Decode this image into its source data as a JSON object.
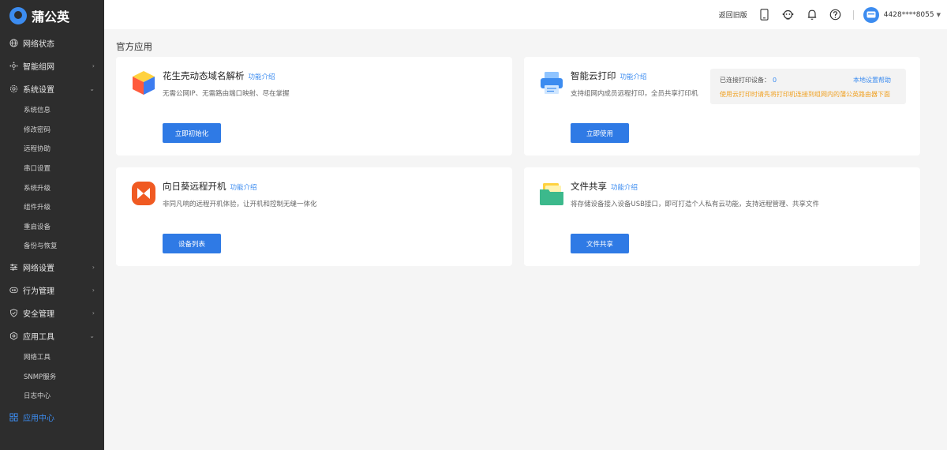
{
  "logo": {
    "text": "蒲公英"
  },
  "sidebar": {
    "items": [
      {
        "label": "网络状态",
        "icon": "globe-icon",
        "expandable": false
      },
      {
        "label": "智能组网",
        "icon": "network-icon",
        "expandable": true
      },
      {
        "label": "系统设置",
        "icon": "gear-icon",
        "expandable": true,
        "expanded": true,
        "children": [
          "系统信息",
          "修改密码",
          "远程协助",
          "串口设置",
          "系统升级",
          "组件升级",
          "重启设备",
          "备份与恢复"
        ]
      },
      {
        "label": "网络设置",
        "icon": "sliders-icon",
        "expandable": true
      },
      {
        "label": "行为管理",
        "icon": "eye-icon",
        "expandable": true
      },
      {
        "label": "安全管理",
        "icon": "shield-icon",
        "expandable": true
      },
      {
        "label": "应用工具",
        "icon": "tools-icon",
        "expandable": true,
        "expanded": true,
        "children": [
          "网络工具",
          "SNMP服务",
          "日志中心"
        ]
      },
      {
        "label": "应用中心",
        "icon": "grid-icon",
        "expandable": false,
        "active": true
      }
    ]
  },
  "topbar": {
    "back_label": "返回旧版",
    "user_id": "4428****8055"
  },
  "section_title": "官方应用",
  "intro_label": "功能介绍",
  "cards": [
    {
      "title": "花生壳动态域名解析",
      "desc": "无需公网IP、无需路由端口映射、尽在掌握",
      "button": "立即初始化"
    },
    {
      "title": "智能云打印",
      "desc": "支持组网内成员远程打印，全员共享打印机",
      "button": "立即使用"
    },
    {
      "title": "向日葵远程开机",
      "desc": "非同凡响的远程开机体验，让开机和控制无缝一体化",
      "button": "设备列表"
    },
    {
      "title": "文件共享",
      "desc": "将存储设备接入设备USB接口，即可打造个人私有云功能，支持远程管理、共享文件",
      "button": "文件共享"
    }
  ],
  "print_info": {
    "connected_label": "已连接打印设备：",
    "connected_count": "0",
    "help_label": "本地设置帮助",
    "tip": "使用云打印时请先将打印机连接到组网内的蒲公英路由器下面"
  },
  "colors": {
    "accent": "#2f7ae5",
    "sidebar_bg": "#2d2d2d",
    "warning": "#f0a020"
  }
}
